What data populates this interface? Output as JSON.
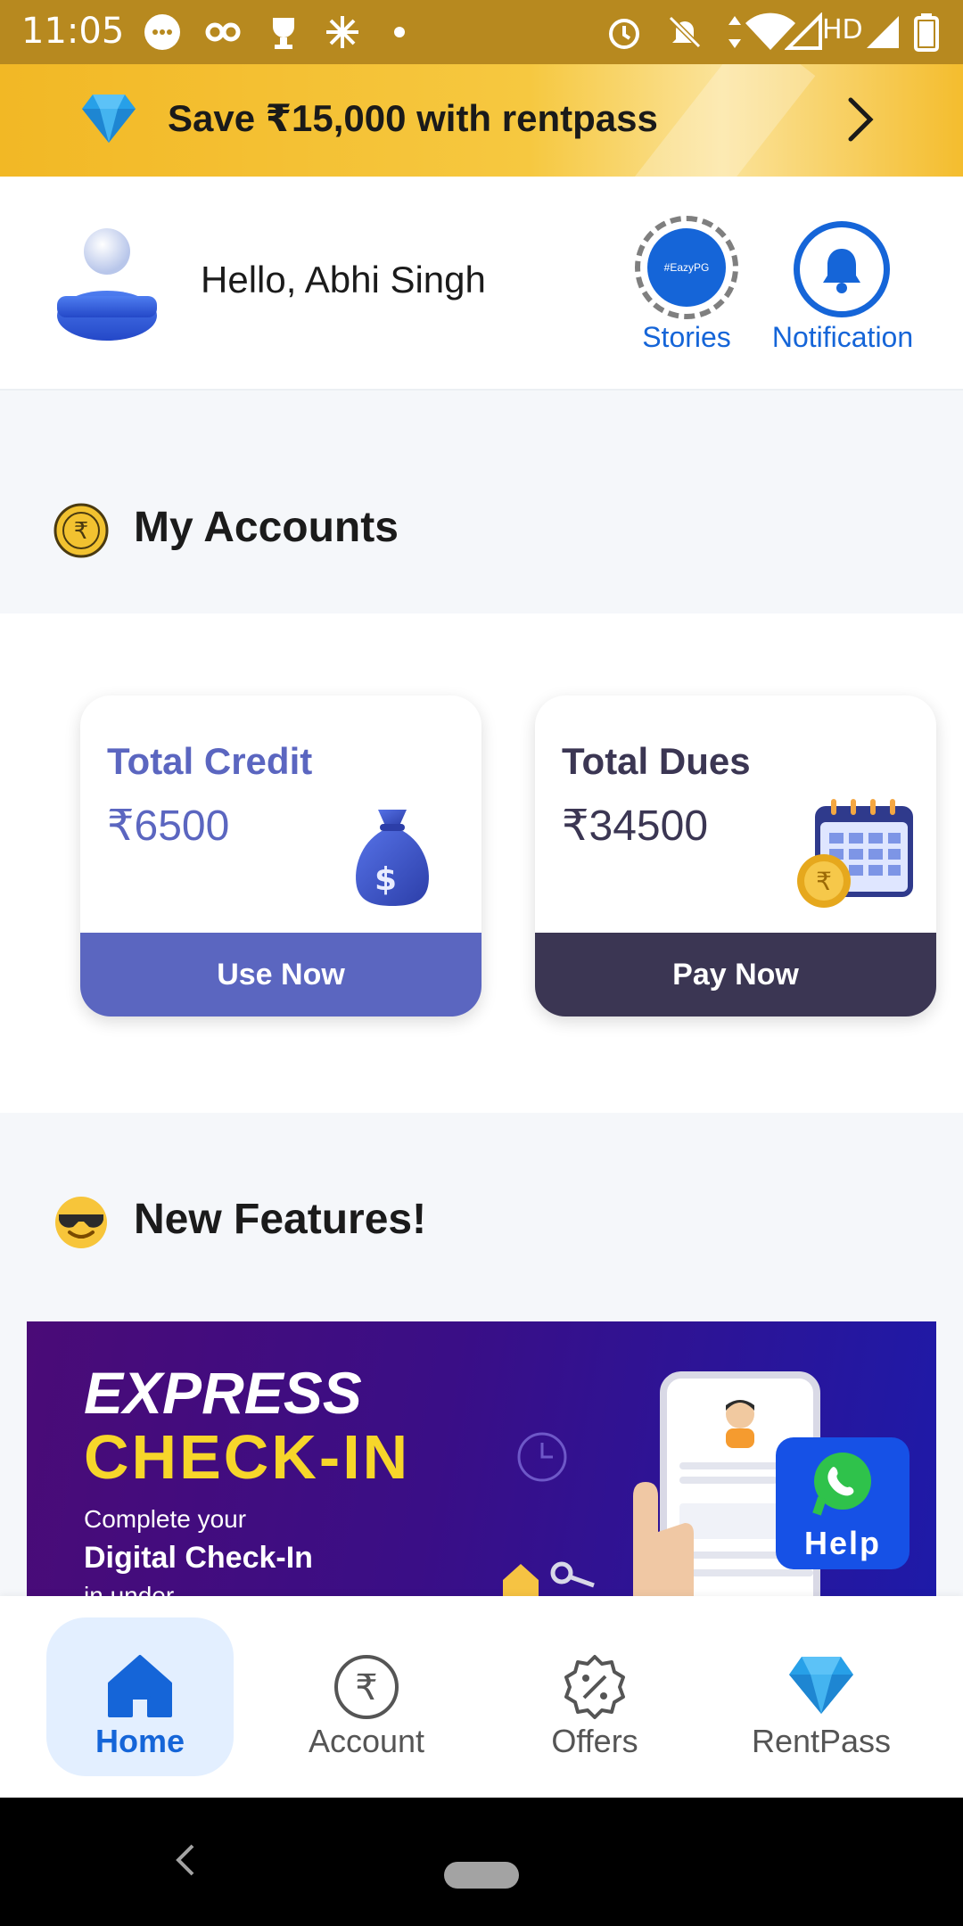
{
  "status_bar": {
    "time": "11:05",
    "network_label": "HD"
  },
  "promo_banner": {
    "text": "Save ₹15,000 with rentpass"
  },
  "header": {
    "greeting": "Hello, Abhi Singh",
    "stories_badge": "#EazyPG",
    "stories_label": "Stories",
    "notification_label": "Notification"
  },
  "accounts": {
    "title": "My Accounts",
    "credit": {
      "title": "Total Credit",
      "amount": "₹6500",
      "button": "Use Now"
    },
    "dues": {
      "title": "Total Dues",
      "amount": "₹34500",
      "button": "Pay Now"
    }
  },
  "features": {
    "title": "New Features!",
    "banner": {
      "line1": "EXPRESS",
      "line2": "CHECK-IN",
      "line3": "Complete your",
      "line4": "Digital Check-In",
      "line5": "in under"
    }
  },
  "help_button": {
    "label": "Help"
  },
  "bottom_nav": {
    "items": [
      {
        "label": "Home",
        "icon": "home-icon",
        "active": true
      },
      {
        "label": "Account",
        "icon": "rupee-icon",
        "active": false
      },
      {
        "label": "Offers",
        "icon": "percent-badge-icon",
        "active": false
      },
      {
        "label": "RentPass",
        "icon": "diamond-icon",
        "active": false
      }
    ]
  },
  "colors": {
    "status_bar": "#b7891f",
    "brand_blue": "#1565d8",
    "credit_accent": "#5b66c0",
    "dues_accent": "#3b3653",
    "promo_yellow": "#f4bd2e"
  }
}
